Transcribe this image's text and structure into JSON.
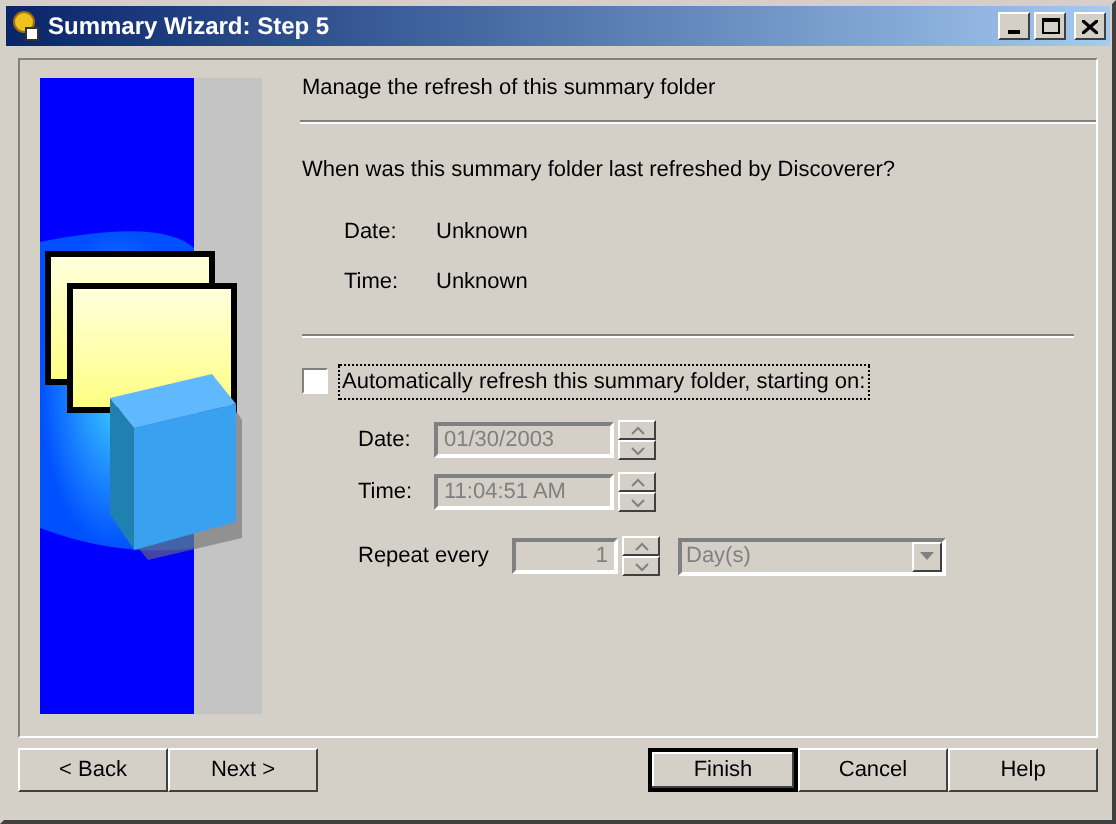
{
  "window": {
    "title": "Summary Wizard: Step 5"
  },
  "header": "Manage the refresh of this summary folder",
  "question": "When was this summary folder last refreshed by Discoverer?",
  "last_refresh": [
    {
      "label": "Date:",
      "value": "Unknown"
    },
    {
      "label": "Time:",
      "value": "Unknown"
    }
  ],
  "auto_refresh": {
    "label": "Automatically refresh this summary folder, starting on:",
    "checked": false,
    "fields": [
      {
        "label": "Date:",
        "value": "01/30/2003",
        "disabled": true
      },
      {
        "label": "Time:",
        "value": "11:04:51 AM",
        "disabled": true
      }
    ],
    "repeat": {
      "label": "Repeat every",
      "value": "1",
      "unit": "Day(s)",
      "disabled": true
    }
  },
  "buttons": [
    {
      "label": "< Back",
      "default": false
    },
    {
      "label": "Next >",
      "default": false
    },
    {
      "label": "Finish",
      "default": true
    },
    {
      "label": "Cancel",
      "default": false
    },
    {
      "label": "Help",
      "default": false
    }
  ]
}
